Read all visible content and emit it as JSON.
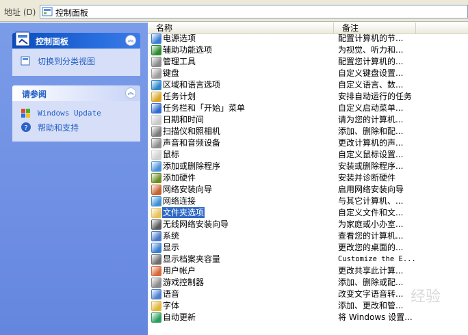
{
  "address_bar": {
    "label": "地址 (D)",
    "value": "控制面板"
  },
  "left_pane": {
    "control_panel": {
      "title": "控制面板",
      "links": [
        {
          "label": "切换到分类视图",
          "icon": "category-view-icon"
        }
      ]
    },
    "see_also": {
      "title": "请参阅",
      "links": [
        {
          "label": "Windows Update",
          "icon": "windows-update-icon"
        },
        {
          "label": "帮助和支持",
          "icon": "help-icon"
        }
      ]
    }
  },
  "list": {
    "columns": {
      "name": "名称",
      "comment": "备注"
    },
    "items": [
      {
        "name": "电源选项",
        "comment": "配置计算机的节...",
        "color": "#3a7bd5"
      },
      {
        "name": "辅助功能选项",
        "comment": "为视觉、听力和...",
        "color": "#2e8b2e"
      },
      {
        "name": "管理工具",
        "comment": "配置您计算机的...",
        "color": "#8a8a8a"
      },
      {
        "name": "键盘",
        "comment": "自定义键盘设置...",
        "color": "#9b9b9b"
      },
      {
        "name": "区域和语言选项",
        "comment": "自定义语言、数...",
        "color": "#2d86c9"
      },
      {
        "name": "任务计划",
        "comment": "安排自动运行的任务",
        "color": "#d9a62b"
      },
      {
        "name": "任务栏和「开始」菜单",
        "comment": "自定义启动菜单...",
        "color": "#2f6bd1"
      },
      {
        "name": "日期和时间",
        "comment": "请为您的计算机...",
        "color": "#c9c9c9"
      },
      {
        "name": "扫描仪和照相机",
        "comment": "添加、删除和配...",
        "color": "#7a7a7a"
      },
      {
        "name": "声音和音频设备",
        "comment": "更改计算机的声...",
        "color": "#8c8c8c"
      },
      {
        "name": "鼠标",
        "comment": "自定义鼠标设置...",
        "color": "#d0d0d0"
      },
      {
        "name": "添加或删除程序",
        "comment": "安装或删除程序...",
        "color": "#4a90d9"
      },
      {
        "name": "添加硬件",
        "comment": "安装并诊断硬件",
        "color": "#6b8e23"
      },
      {
        "name": "网络安装向导",
        "comment": "启用网络安装向导",
        "color": "#c4632f"
      },
      {
        "name": "网络连接",
        "comment": "与其它计算机、...",
        "color": "#3f8fd4"
      },
      {
        "name": "文件夹选项",
        "comment": "自定义文件和文...",
        "color": "#e8c25a",
        "selected": true
      },
      {
        "name": "无线网络安装向导",
        "comment": "为家庭或小办室...",
        "color": "#5a5a5a"
      },
      {
        "name": "系统",
        "comment": "查看您的计算机...",
        "color": "#4a78c4"
      },
      {
        "name": "显示",
        "comment": "更改您的桌面的...",
        "color": "#3a7fd0"
      },
      {
        "name": "显示档案夹容量",
        "comment": "Customize the E...",
        "color": "#6e6e6e",
        "mono": true
      },
      {
        "name": "用户帐户",
        "comment": "更改共享此计算...",
        "color": "#d6693a"
      },
      {
        "name": "游戏控制器",
        "comment": "添加、删除或配...",
        "color": "#8a8a8a"
      },
      {
        "name": "语音",
        "comment": "改变文字语音转...",
        "color": "#4d7fcf"
      },
      {
        "name": "字体",
        "comment": "添加、更改和管...",
        "color": "#e0b73a"
      },
      {
        "name": "自动更新",
        "comment": "将 Windows 设置...",
        "color": "#2a9d5c"
      }
    ]
  },
  "watermark": "经验"
}
